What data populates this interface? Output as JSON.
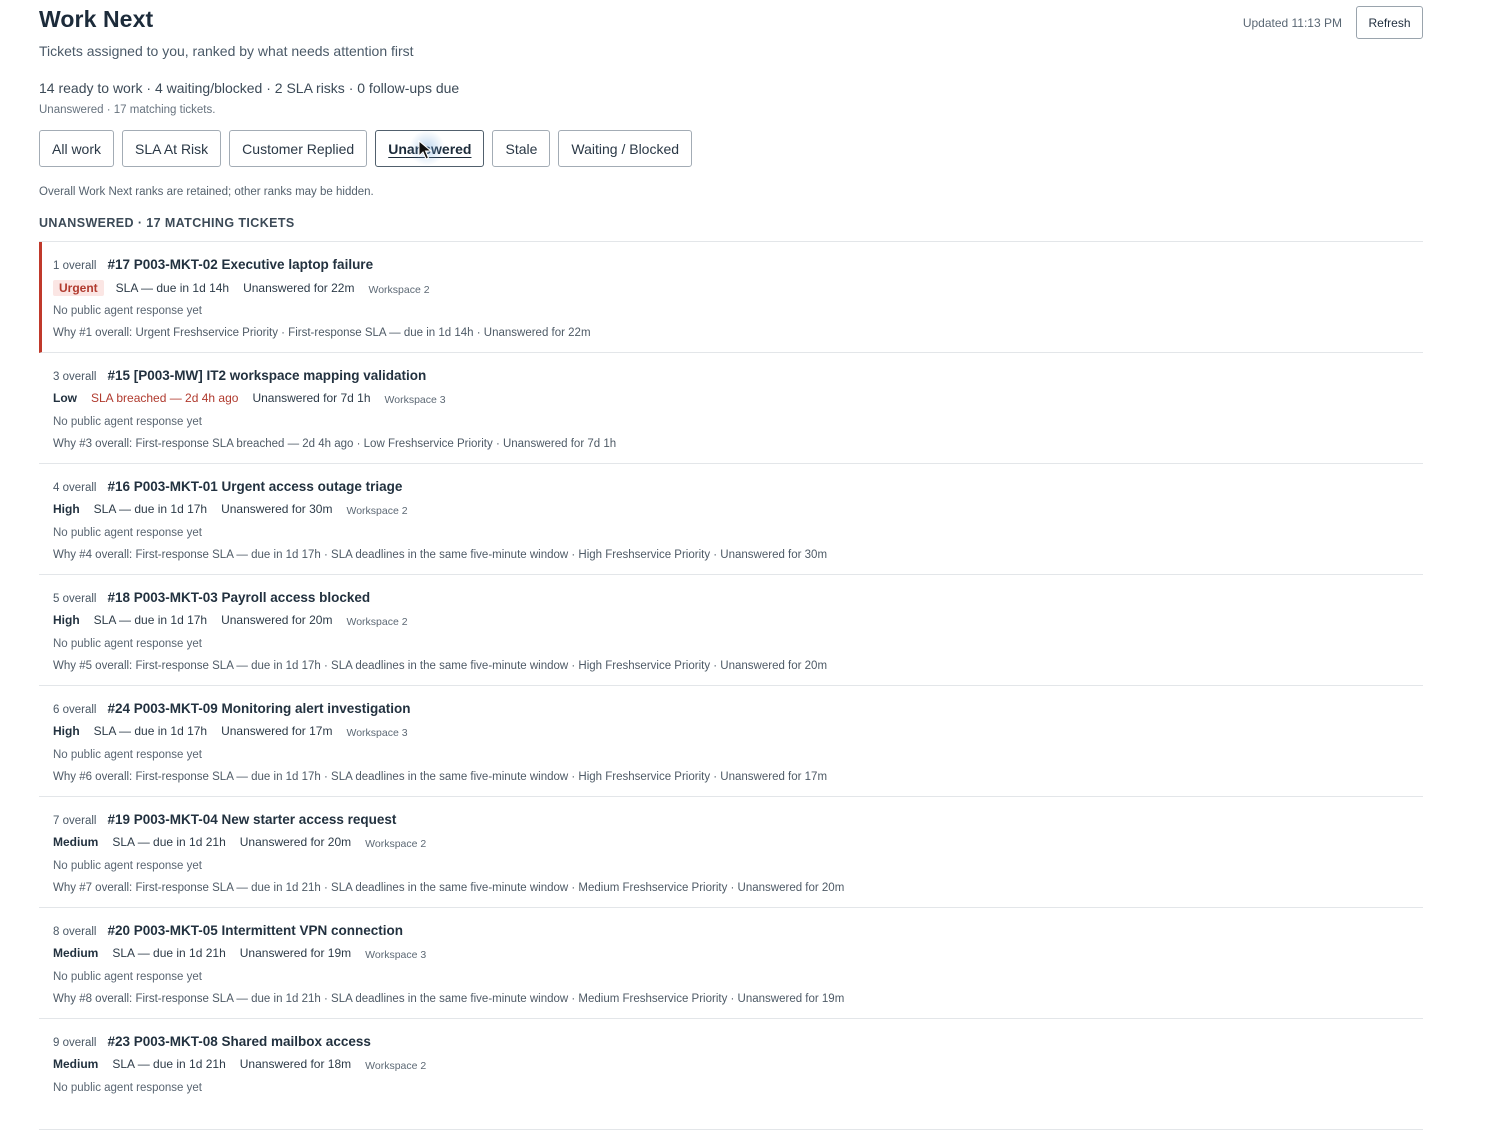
{
  "header": {
    "title": "Work Next",
    "subtitle": "Tickets assigned to you, ranked by what needs attention first",
    "updated": "Updated 11:13 PM",
    "refresh_label": "Refresh"
  },
  "summary": "14 ready to work · 4 waiting/blocked · 2 SLA risks · 0 follow-ups due",
  "filter_note": "Unanswered · 17 matching tickets.",
  "tabs": [
    {
      "label": "All work",
      "active": false
    },
    {
      "label": "SLA At Risk",
      "active": false
    },
    {
      "label": "Customer Replied",
      "active": false
    },
    {
      "label": "Unanswered",
      "active": true
    },
    {
      "label": "Stale",
      "active": false
    },
    {
      "label": "Waiting / Blocked",
      "active": false
    }
  ],
  "ranks_note": "Overall Work Next ranks are retained; other ranks may be hidden.",
  "section_heading": "UNANSWERED · 17 MATCHING TICKETS",
  "colors": {
    "accent_red": "#c0392b",
    "urgent_bg": "#fbe6e4"
  },
  "tickets": [
    {
      "rank": "1 overall",
      "title": "#17 P003-MKT-02 Executive laptop failure",
      "priority": "Urgent",
      "sla": "SLA — due in 1d 14h",
      "sla_breached": false,
      "unanswered": "Unanswered for 22m",
      "workspace": "Workspace 2",
      "response": "No public agent response yet",
      "why": "Why #1 overall: Urgent Freshservice Priority · First-response SLA — due in 1d 14h · Unanswered for 22m"
    },
    {
      "rank": "3 overall",
      "title": "#15 [P003-MW] IT2 workspace mapping validation",
      "priority": "Low",
      "sla": "SLA breached — 2d 4h ago",
      "sla_breached": true,
      "unanswered": "Unanswered for 7d 1h",
      "workspace": "Workspace 3",
      "response": "No public agent response yet",
      "why": "Why #3 overall: First-response SLA breached — 2d 4h ago · Low Freshservice Priority · Unanswered for 7d 1h"
    },
    {
      "rank": "4 overall",
      "title": "#16 P003-MKT-01 Urgent access outage triage",
      "priority": "High",
      "sla": "SLA — due in 1d 17h",
      "sla_breached": false,
      "unanswered": "Unanswered for 30m",
      "workspace": "Workspace 2",
      "response": "No public agent response yet",
      "why": "Why #4 overall: First-response SLA — due in 1d 17h · SLA deadlines in the same five-minute window · High Freshservice Priority · Unanswered for 30m"
    },
    {
      "rank": "5 overall",
      "title": "#18 P003-MKT-03 Payroll access blocked",
      "priority": "High",
      "sla": "SLA — due in 1d 17h",
      "sla_breached": false,
      "unanswered": "Unanswered for 20m",
      "workspace": "Workspace 2",
      "response": "No public agent response yet",
      "why": "Why #5 overall: First-response SLA — due in 1d 17h · SLA deadlines in the same five-minute window · High Freshservice Priority · Unanswered for 20m"
    },
    {
      "rank": "6 overall",
      "title": "#24 P003-MKT-09 Monitoring alert investigation",
      "priority": "High",
      "sla": "SLA — due in 1d 17h",
      "sla_breached": false,
      "unanswered": "Unanswered for 17m",
      "workspace": "Workspace 3",
      "response": "No public agent response yet",
      "why": "Why #6 overall: First-response SLA — due in 1d 17h · SLA deadlines in the same five-minute window · High Freshservice Priority · Unanswered for 17m"
    },
    {
      "rank": "7 overall",
      "title": "#19 P003-MKT-04 New starter access request",
      "priority": "Medium",
      "sla": "SLA — due in 1d 21h",
      "sla_breached": false,
      "unanswered": "Unanswered for 20m",
      "workspace": "Workspace 2",
      "response": "No public agent response yet",
      "why": "Why #7 overall: First-response SLA — due in 1d 21h · SLA deadlines in the same five-minute window · Medium Freshservice Priority · Unanswered for 20m"
    },
    {
      "rank": "8 overall",
      "title": "#20 P003-MKT-05 Intermittent VPN connection",
      "priority": "Medium",
      "sla": "SLA — due in 1d 21h",
      "sla_breached": false,
      "unanswered": "Unanswered for 19m",
      "workspace": "Workspace 3",
      "response": "No public agent response yet",
      "why": "Why #8 overall: First-response SLA — due in 1d 21h · SLA deadlines in the same five-minute window · Medium Freshservice Priority · Unanswered for 19m"
    },
    {
      "rank": "9 overall",
      "title": "#23 P003-MKT-08 Shared mailbox access",
      "priority": "Medium",
      "sla": "SLA — due in 1d 21h",
      "sla_breached": false,
      "unanswered": "Unanswered for 18m",
      "workspace": "Workspace 2",
      "response": "No public agent response yet",
      "why": ""
    }
  ]
}
